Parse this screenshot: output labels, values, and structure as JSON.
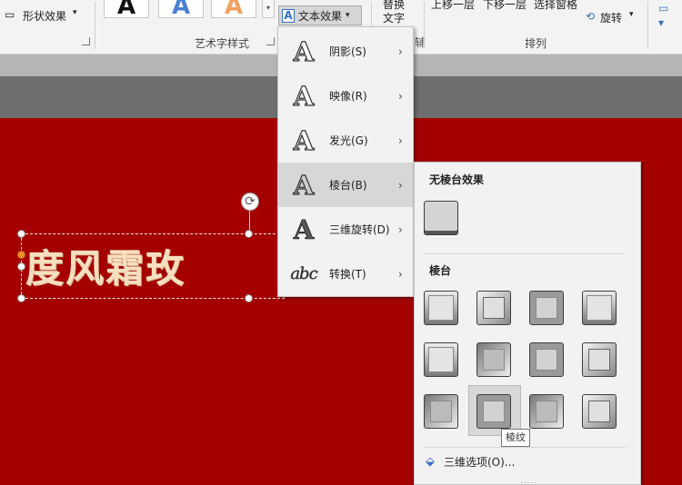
{
  "ribbon": {
    "shape_effect_label": "形状效果",
    "wordart_group_label": "艺术字样式",
    "wordart_sample": "A",
    "text_effect_label": "文本效果",
    "alt_text_label_1": "替换",
    "alt_text_label_2": "文字",
    "bring_forward_label": "上移一层",
    "send_backward_label": "下移一层",
    "selection_pane_label": "选择窗格",
    "rotate_label": "旋转",
    "arrange_group_label": "排列",
    "colors": {
      "sample_black": "#111111",
      "sample_blue": "#4a7fd1",
      "sample_orange": "#f0a060"
    }
  },
  "slide": {
    "wordart_text": "度风霜玫"
  },
  "text_effect_menu": {
    "items": [
      {
        "label": "阴影(S)",
        "icon": "A",
        "icon_name": "shadow-icon"
      },
      {
        "label": "映像(R)",
        "icon": "A",
        "icon_name": "reflection-icon"
      },
      {
        "label": "发光(G)",
        "icon": "A",
        "icon_name": "glow-icon"
      },
      {
        "label": "棱台(B)",
        "icon": "A",
        "icon_name": "bevel-icon",
        "active": true
      },
      {
        "label": "三维旋转(D)",
        "icon": "A",
        "icon_name": "3d-rotation-icon"
      },
      {
        "label": "转换(T)",
        "icon": "abc",
        "icon_name": "transform-icon"
      }
    ],
    "arrow": "›"
  },
  "bevel_submenu": {
    "no_bevel_heading": "无棱台效果",
    "bevel_heading": "棱台",
    "tooltip": "棱纹",
    "options_label": "三维选项(O)...",
    "dots": "....."
  }
}
